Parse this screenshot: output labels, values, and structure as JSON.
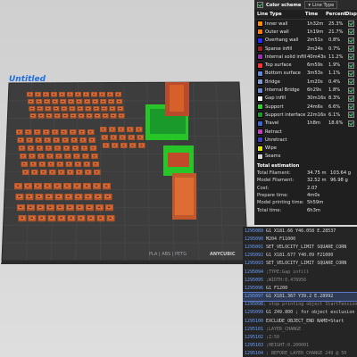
{
  "plate": {
    "label": "Untitled",
    "footer_left": "PLA | ABS | PETG",
    "footer_right": "ANYCUBIC"
  },
  "legend": {
    "scheme_label": "Color scheme",
    "scheme_value": "Line Type",
    "cols": [
      "Line Type",
      "Time",
      "Percent",
      "Display"
    ],
    "rows": [
      {
        "name": "Inner wall",
        "time": "1h32m",
        "pct": "25.3%",
        "color": "#ff8c00"
      },
      {
        "name": "Outer wall",
        "time": "1h19m",
        "pct": "21.7%",
        "color": "#ff7a00"
      },
      {
        "name": "Overhang wall",
        "time": "2m51s",
        "pct": "0.8%",
        "color": "#2b2bff"
      },
      {
        "name": "Sparse infill",
        "time": "2m24s",
        "pct": "0.7%",
        "color": "#a02020"
      },
      {
        "name": "Internal solid infill",
        "time": "40m43s",
        "pct": "11.2%",
        "color": "#9b2fb3"
      },
      {
        "name": "Top surface",
        "time": "6m59s",
        "pct": "1.9%",
        "color": "#ff3030"
      },
      {
        "name": "Bottom surface",
        "time": "3m53s",
        "pct": "1.1%",
        "color": "#5a8bd6"
      },
      {
        "name": "Bridge",
        "time": "1m20s",
        "pct": "0.4%",
        "color": "#7a9bd0"
      },
      {
        "name": "Internal Bridge",
        "time": "6h29s",
        "pct": "1.8%",
        "color": "#6a8ad0"
      },
      {
        "name": "Gap infill",
        "time": "30m16s",
        "pct": "8.3%",
        "color": "#f5f5f5"
      },
      {
        "name": "Support",
        "time": "24m6s",
        "pct": "6.6%",
        "color": "#28d628"
      },
      {
        "name": "Support interface",
        "time": "22m16s",
        "pct": "6.1%",
        "color": "#1a9a2a"
      },
      {
        "name": "Travel",
        "time": "1h8m",
        "pct": "18.6%",
        "color": "#3a6ad0"
      }
    ],
    "toggles": [
      {
        "name": "Retract",
        "color": "#c040c0"
      },
      {
        "name": "Unretract",
        "color": "#4040c0"
      },
      {
        "name": "Wipe",
        "color": "#e6e600"
      },
      {
        "name": "Seams",
        "color": "#d8d8d8"
      }
    ],
    "estimation_title": "Total estimation",
    "estimation": [
      {
        "k": "Total Filament:",
        "v": "34.75 m",
        "v2": "103.64 g"
      },
      {
        "k": "Model Filament:",
        "v": "32.52 m",
        "v2": "96.98 g"
      },
      {
        "k": "Cost:",
        "v": "2.07",
        "v2": ""
      },
      {
        "k": "Prepare time:",
        "v": "4m0s",
        "v2": ""
      },
      {
        "k": "Model printing time:",
        "v": "5h59m",
        "v2": ""
      },
      {
        "k": "Total time:",
        "v": "6h3m",
        "v2": ""
      }
    ]
  },
  "gcode": [
    {
      "n": "1295089",
      "t": "G1 X181.66 Y46.058 E.28537",
      "dim": false
    },
    {
      "n": "1295090",
      "t": "M204 F11000",
      "dim": false
    },
    {
      "n": "1295091",
      "t": "SET_VELOCITY_LIMIT SQUARE_CORN",
      "dim": false
    },
    {
      "n": "1295092",
      "t": "G1 X181.677 Y40.09 F21000",
      "dim": false
    },
    {
      "n": "1295093",
      "t": "SET_VELOCITY_LIMIT SQUARE_CORN",
      "dim": false
    },
    {
      "n": "1295094",
      "t": ";TYPE:Gap infill",
      "dim": true
    },
    {
      "n": "1295095",
      "t": ";WIDTH:0.478956",
      "dim": true
    },
    {
      "n": "1295096",
      "t": "G1 F1200",
      "dim": false
    },
    {
      "n": "1295097",
      "t": "G1 X181.367 Y39.2 E.28992",
      "dim": false,
      "sel": true
    },
    {
      "n": "1295098",
      "t": "; stop printing object StartTensional",
      "dim": true
    },
    {
      "n": "1295099",
      "t": "G1 Z49.800 ; for object exclusion",
      "dim": false
    },
    {
      "n": "1295100",
      "t": "EXCLUDE_OBJECT_END NAME=Start",
      "dim": false
    },
    {
      "n": "1295101",
      "t": ";LAYER_CHANGE",
      "dim": true
    },
    {
      "n": "1295102",
      "t": ";Z:50",
      "dim": true
    },
    {
      "n": "1295103",
      "t": ";HEIGHT:0.200001",
      "dim": true
    },
    {
      "n": "1295104",
      "t": "; BEFORE_LAYER_CHANGE 249 @ 50",
      "dim": true
    }
  ]
}
